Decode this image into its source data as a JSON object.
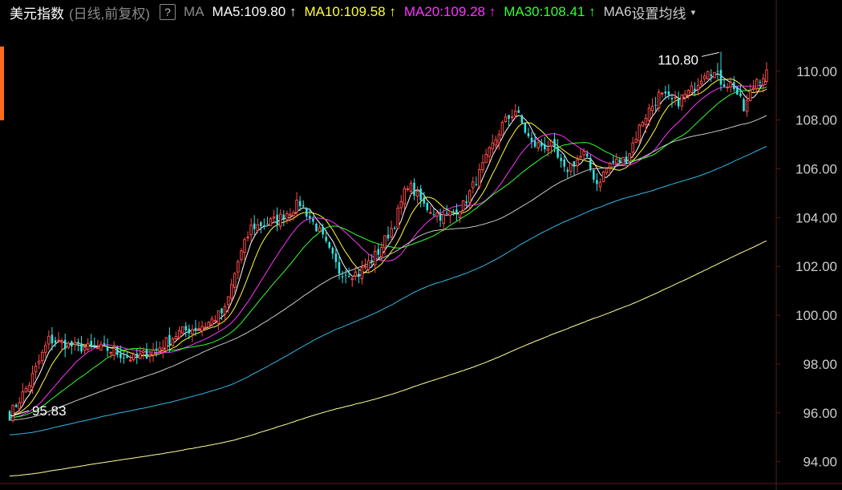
{
  "header": {
    "title": "美元指数",
    "subtitle": "(日线,前复权)",
    "help_label": "?",
    "ma_label": "MA",
    "ma_items": [
      {
        "label": "MA5:109.80",
        "arrow": "↑",
        "color": "#ffffff"
      },
      {
        "label": "MA10:109.58",
        "arrow": "↑",
        "color": "#ffff33"
      },
      {
        "label": "MA20:109.28",
        "arrow": "↑",
        "color": "#ff33ff"
      },
      {
        "label": "MA30:108.41",
        "arrow": "↑",
        "color": "#33ff33"
      }
    ],
    "ma_more": "MA6",
    "settings_label": "设置均线",
    "settings_caret": "▾"
  },
  "chart_data": {
    "type": "candlestick",
    "ylim": [
      93.2,
      111.8
    ],
    "y_ticks": [
      "94.00",
      "96.00",
      "98.00",
      "100.00",
      "102.00",
      "104.00",
      "106.00",
      "108.00",
      "110.00"
    ],
    "annotations": {
      "high": "110.80",
      "low": "95.83"
    },
    "up_color": "#ff4a4a",
    "down_color": "#33e6e6",
    "candles": [],
    "moving_averages": [
      {
        "name": "MA5",
        "color": "#ffffff",
        "values": []
      },
      {
        "name": "MA10",
        "color": "#ffff33",
        "values": []
      },
      {
        "name": "MA20",
        "color": "#ff33ff",
        "values": []
      },
      {
        "name": "MA30",
        "color": "#33ff33",
        "values": []
      },
      {
        "name": "MA60",
        "color": "#c8c8c8",
        "values": []
      },
      {
        "name": "MA120",
        "color": "#2fb8e6",
        "values": []
      },
      {
        "name": "MA250",
        "color": "#ffff99",
        "values": []
      }
    ]
  }
}
